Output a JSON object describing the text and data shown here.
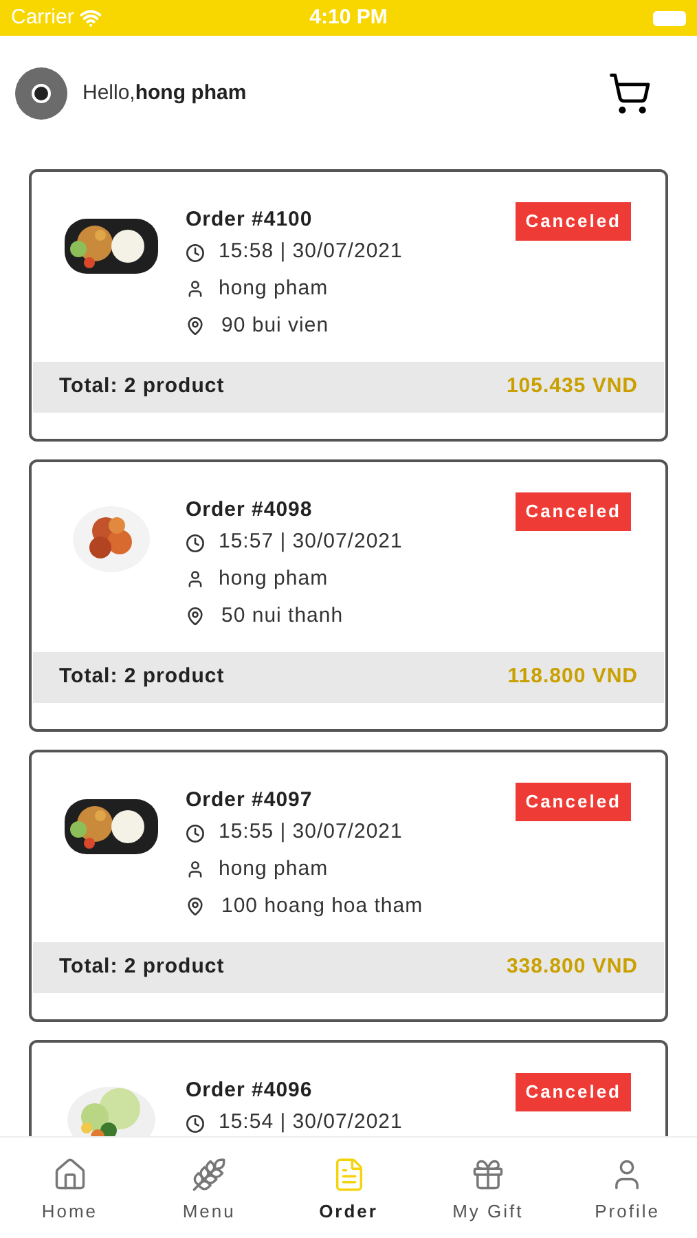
{
  "status_bar": {
    "carrier": "Carrier",
    "time": "4:10 PM"
  },
  "header": {
    "greeting": "Hello,",
    "user_name": "hong pham"
  },
  "orders": [
    {
      "title": "Order #4100",
      "status": "Canceled",
      "time": "15:58 | 30/07/2021",
      "customer": "hong pham",
      "address": "90 bui vien",
      "total_label": "Total: 2 product",
      "total": "105.435 VND"
    },
    {
      "title": "Order #4098",
      "status": "Canceled",
      "time": "15:57 | 30/07/2021",
      "customer": "hong pham",
      "address": "50 nui thanh",
      "total_label": "Total: 2 product",
      "total": "118.800 VND"
    },
    {
      "title": "Order #4097",
      "status": "Canceled",
      "time": "15:55 | 30/07/2021",
      "customer": "hong pham",
      "address": "100 hoang hoa tham",
      "total_label": "Total: 2 product",
      "total": "338.800 VND"
    },
    {
      "title": "Order #4096",
      "status": "Canceled",
      "time": "15:54 | 30/07/2021"
    }
  ],
  "tab_bar": [
    {
      "label": "Home",
      "selected": false
    },
    {
      "label": "Menu",
      "selected": false
    },
    {
      "label": "Order",
      "selected": true
    },
    {
      "label": "My Gift",
      "selected": false
    },
    {
      "label": "Profile",
      "selected": false
    }
  ]
}
